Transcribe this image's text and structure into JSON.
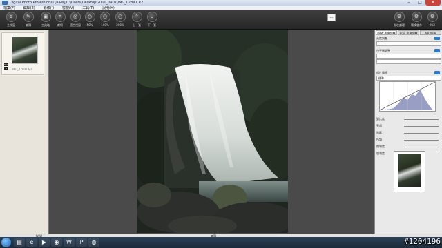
{
  "window": {
    "title": "Digital Photo Professional [RAW] C:\\Users\\Desktop\\2010_0907\\IMG_0789.CR2"
  },
  "menu": [
    "檔案(F)",
    "編輯(E)",
    "影像(I)",
    "檢視(V)",
    "工具(T)",
    "說明(H)"
  ],
  "toolbar": [
    {
      "label": "主視窗",
      "icon": "home-icon"
    },
    {
      "label": "編輯",
      "icon": "edit-icon"
    },
    {
      "label": "工具箱",
      "icon": "toolbox-icon"
    },
    {
      "label": "裁切",
      "icon": "crop-icon"
    },
    {
      "label": "適合視窗",
      "icon": "fit-icon"
    },
    {
      "label": "50%",
      "icon": "zoom-50-icon"
    },
    {
      "label": "100%",
      "icon": "zoom-100-icon"
    },
    {
      "label": "200%",
      "icon": "zoom-200-icon"
    },
    {
      "label": "上一張",
      "icon": "prev-icon"
    },
    {
      "label": "下一張",
      "icon": "next-icon"
    }
  ],
  "toolbar_right": [
    {
      "label": "批次處理",
      "icon": "batch-icon"
    },
    {
      "label": "轉換儲存",
      "icon": "save-icon"
    },
    {
      "label": "列印",
      "icon": "print-icon"
    }
  ],
  "zoom_value": "8%",
  "thumbnail": {
    "filename": "IMG_0789.CR2",
    "badges": [
      "RAW",
      "★"
    ]
  },
  "right_panel": {
    "tabs": [
      "RAW 影像調整",
      "RGB 影像調整",
      "NR/鏡頭"
    ],
    "sections": [
      {
        "label": "亮度調整"
      },
      {
        "label": "白平衡調整"
      },
      {
        "label": "相片風格"
      }
    ],
    "style_value": "標準",
    "sliders": [
      {
        "label": "對比度"
      },
      {
        "label": "亮部"
      },
      {
        "label": "陰影"
      },
      {
        "label": "色調"
      },
      {
        "label": "飽和度"
      },
      {
        "label": "銳利度"
      }
    ]
  },
  "statusbar": {
    "left": "RAW",
    "right": "編輯"
  },
  "taskbar": {
    "items": [
      "folder-icon",
      "browser-icon",
      "media-icon",
      "dpp-icon",
      "word-icon",
      "ppt-icon",
      "firefox-icon"
    ]
  },
  "watermark": "#1204196",
  "colors": {
    "titlebar": "#c7d4e6",
    "toolbar": "#262626",
    "accent": "#2b7bd3",
    "close": "#c9443a"
  }
}
